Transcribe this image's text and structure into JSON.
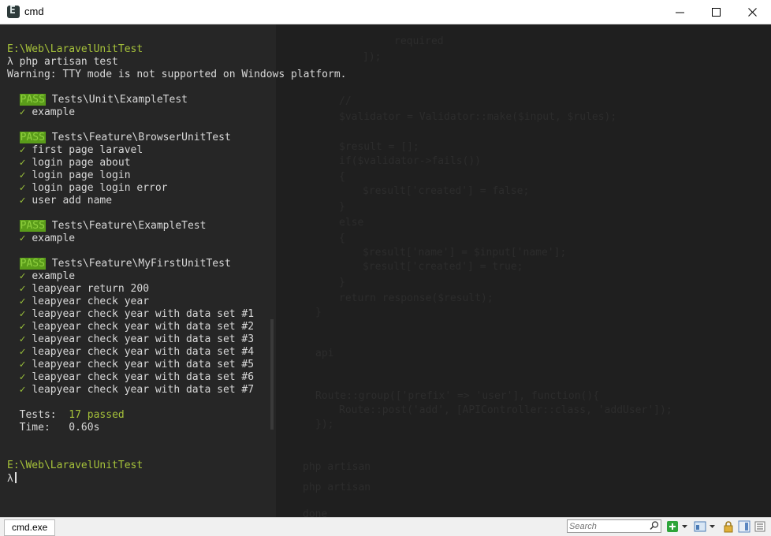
{
  "window": {
    "title": "cmd"
  },
  "terminal": {
    "lines": [
      {
        "type": "path",
        "text": "E:\\Web\\LaravelUnitTest"
      },
      {
        "type": "prompt",
        "prompt": "λ",
        "text": "php artisan test"
      },
      {
        "type": "plain",
        "text": "Warning: TTY mode is not supported on Windows platform."
      },
      {
        "type": "blank"
      },
      {
        "type": "pass",
        "badge": "PASS",
        "text": "Tests\\Unit\\ExampleTest"
      },
      {
        "type": "check",
        "mark": "✓",
        "text": "example"
      },
      {
        "type": "blank"
      },
      {
        "type": "pass",
        "badge": "PASS",
        "text": "Tests\\Feature\\BrowserUnitTest"
      },
      {
        "type": "check",
        "mark": "✓",
        "text": "first page laravel"
      },
      {
        "type": "check",
        "mark": "✓",
        "text": "login page about"
      },
      {
        "type": "check",
        "mark": "✓",
        "text": "login page login"
      },
      {
        "type": "check",
        "mark": "✓",
        "text": "login page login error"
      },
      {
        "type": "check",
        "mark": "✓",
        "text": "user add name"
      },
      {
        "type": "blank"
      },
      {
        "type": "pass",
        "badge": "PASS",
        "text": "Tests\\Feature\\ExampleTest"
      },
      {
        "type": "check",
        "mark": "✓",
        "text": "example"
      },
      {
        "type": "blank"
      },
      {
        "type": "pass",
        "badge": "PASS",
        "text": "Tests\\Feature\\MyFirstUnitTest"
      },
      {
        "type": "check",
        "mark": "✓",
        "text": "example"
      },
      {
        "type": "check",
        "mark": "✓",
        "text": "leapyear return 200"
      },
      {
        "type": "check",
        "mark": "✓",
        "text": "leapyear check year"
      },
      {
        "type": "check",
        "mark": "✓",
        "text": "leapyear check year with data set #1"
      },
      {
        "type": "check",
        "mark": "✓",
        "text": "leapyear check year with data set #2"
      },
      {
        "type": "check",
        "mark": "✓",
        "text": "leapyear check year with data set #3"
      },
      {
        "type": "check",
        "mark": "✓",
        "text": "leapyear check year with data set #4"
      },
      {
        "type": "check",
        "mark": "✓",
        "text": "leapyear check year with data set #5"
      },
      {
        "type": "check",
        "mark": "✓",
        "text": "leapyear check year with data set #6"
      },
      {
        "type": "check",
        "mark": "✓",
        "text": "leapyear check year with data set #7"
      },
      {
        "type": "blank"
      },
      {
        "type": "summary",
        "label": "Tests:  ",
        "value": "17 passed"
      },
      {
        "type": "summary_plain",
        "label": "Time:   ",
        "value": "0.60s"
      },
      {
        "type": "blank"
      },
      {
        "type": "blank"
      },
      {
        "type": "path",
        "text": "E:\\Web\\LaravelUnitTest"
      },
      {
        "type": "prompt_cursor",
        "prompt": "λ"
      }
    ]
  },
  "bottombar": {
    "tab_label": "cmd.exe",
    "search_placeholder": "Search"
  },
  "colors": {
    "console_bg": "#262626",
    "path_green": "#a6c23a",
    "pass_badge_bg": "#5a9c1a"
  }
}
